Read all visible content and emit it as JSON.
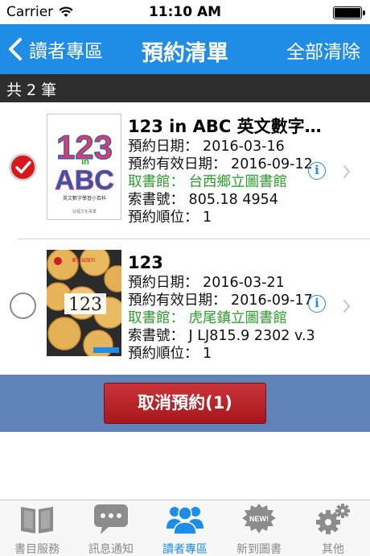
{
  "status_bar": {
    "carrier": "Carrier",
    "time": "11:10 AM"
  },
  "nav": {
    "back_label": "讀者專區",
    "title": "預約清單",
    "clear_all": "全部清除"
  },
  "summary": {
    "count_text": "共 2 筆"
  },
  "reservations": [
    {
      "selected": true,
      "title": "123 in ABC 英文數字…",
      "reserve_date": "預約日期： 2016-03-16",
      "valid_date": "預約有效日期： 2016-09-12",
      "pickup": "取書館： 台西鄉立圖書館",
      "call_number": "索書號： 805.18 4954",
      "queue": "預約順位： 1",
      "cover": {
        "big": "123",
        "small": "in",
        "abc": "ABC",
        "subtitle": "英文數字學習小百科",
        "publisher": "幼福文化事業"
      }
    },
    {
      "selected": false,
      "title": "123",
      "reserve_date": "預約日期： 2016-03-21",
      "valid_date": "預約有效日期： 2016-09-17",
      "pickup": "取書館： 虎尾鎮立圖書館",
      "call_number": "索書號： J LJ815.9 2302 v.3",
      "queue": "預約順位： 1",
      "cover": {
        "big": "123",
        "series": "東方出版社"
      }
    }
  ],
  "info_icon": "i",
  "actions": {
    "cancel_label": "取消預約(1)"
  },
  "tabs": [
    {
      "label": "書目服務",
      "icon": "book-icon",
      "active": false
    },
    {
      "label": "訊息通知",
      "icon": "chat-icon",
      "active": false
    },
    {
      "label": "讀者專區",
      "icon": "users-icon",
      "active": true
    },
    {
      "label": "新到圖書",
      "icon": "new-badge-icon",
      "badge": "NEW!",
      "active": false
    },
    {
      "label": "其他",
      "icon": "gears-icon",
      "active": false
    }
  ],
  "colors": {
    "nav": "#1f8ce6",
    "accent_green": "#2aa12a",
    "cancel": "#b5232a",
    "action_band": "#5f82b7",
    "check_red": "#d7191f"
  }
}
